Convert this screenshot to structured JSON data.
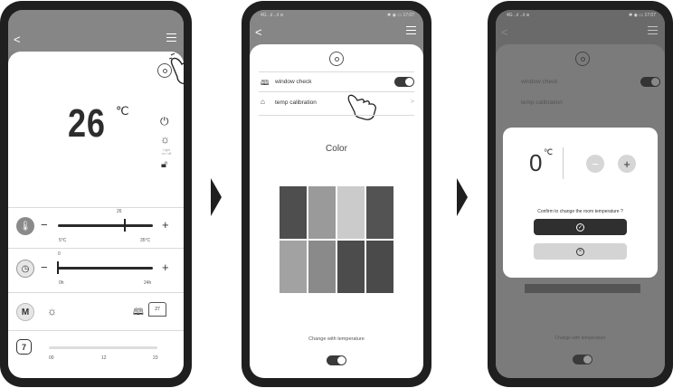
{
  "screen1": {
    "back_glyph": "<",
    "temperature": "26",
    "unit": "℃",
    "light_label": "Light\non / off",
    "temp_slider": {
      "value_label": "26",
      "min_label": "5°C",
      "max_label": "35°C",
      "value": 26,
      "min": 5,
      "max": 35
    },
    "timer_slider": {
      "value_label": "0",
      "min_label": "0h",
      "max_label": "24h",
      "value": 0,
      "min": 0,
      "max": 24
    },
    "minus": "−",
    "plus": "+",
    "mode_label": "M",
    "window_badge": "27",
    "schedule_labels": [
      "00",
      "12",
      "23"
    ]
  },
  "screen2": {
    "settings": [
      {
        "label": "window check",
        "icon": "book-icon",
        "type": "toggle"
      },
      {
        "label": "temp calibration",
        "icon": "house-icon",
        "type": "link"
      }
    ],
    "color_title": "Color",
    "palette": [
      "#4e4e4e",
      "#9a9a9a",
      "#cbcbcb",
      "#535353",
      "#a2a2a2",
      "#8a8a8a",
      "#4c4c4c",
      "#4a4a4a"
    ],
    "change_label": "Change with temperature",
    "chevron": ">"
  },
  "screen3": {
    "status_left": "4G ..ıl ..ıl ≋",
    "status_right": "✱ ◉ ▭ 17:07",
    "dialog_value": "0",
    "dialog_unit": "℃",
    "minus": "−",
    "plus": "+",
    "question": "Confirm to change the room temperature ?",
    "bg_settings": [
      "window check",
      "temp calibration"
    ],
    "bg_change_label": "Change with temperature"
  },
  "colors": {
    "accent_dark": "#2a2a2a",
    "cancel": "#d4d4d4",
    "overlay": "#777777"
  }
}
